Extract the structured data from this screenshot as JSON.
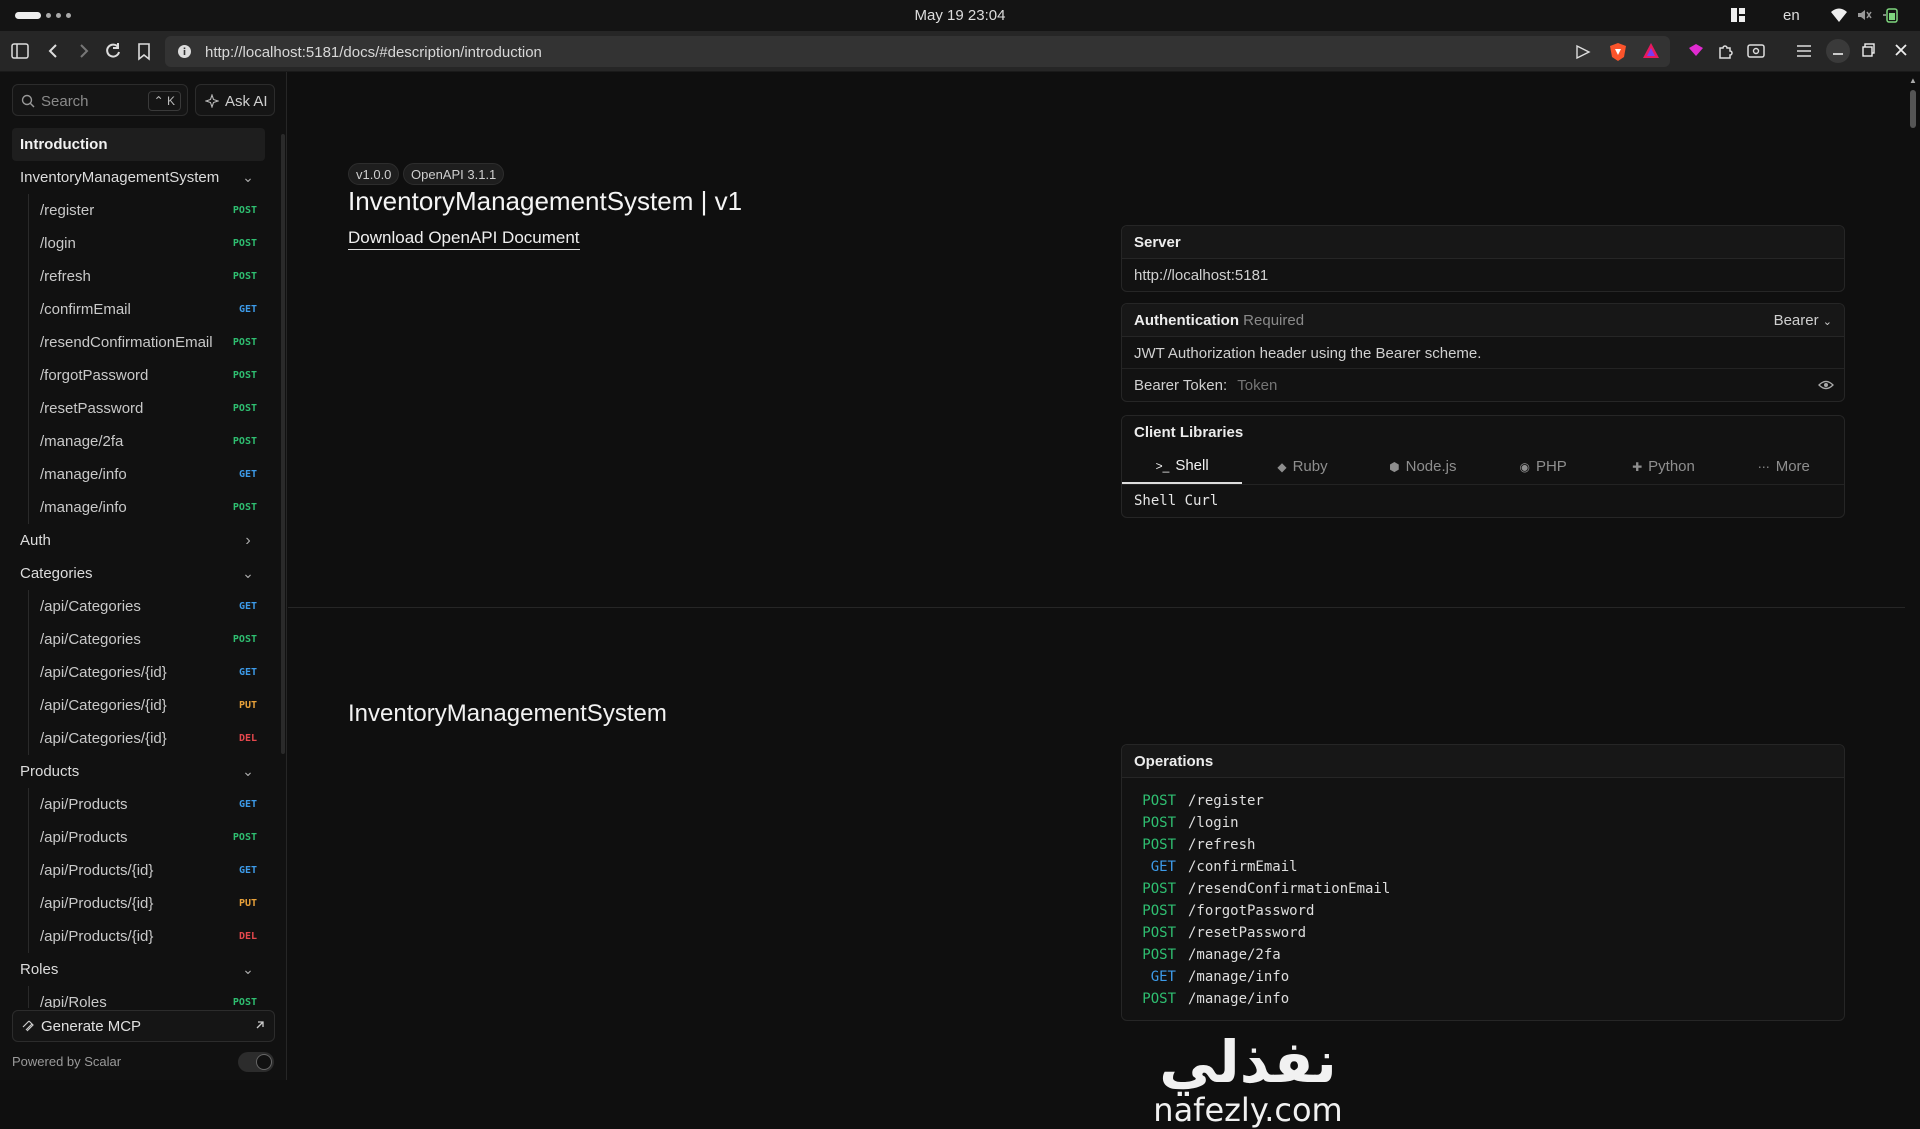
{
  "system": {
    "datetime": "May 19  23:04",
    "lang": "en"
  },
  "browser": {
    "url": "http://localhost:5181/docs/#description/introduction"
  },
  "sidebar": {
    "search_placeholder": "Search",
    "search_shortcut": "⌃ K",
    "ask_ai": "Ask AI",
    "items": [
      {
        "type": "section",
        "label": "Introduction",
        "active": true
      },
      {
        "type": "group",
        "label": "InventoryManagementSystem",
        "expanded": true
      },
      {
        "type": "endpoint",
        "label": "/register",
        "method": "POST"
      },
      {
        "type": "endpoint",
        "label": "/login",
        "method": "POST"
      },
      {
        "type": "endpoint",
        "label": "/refresh",
        "method": "POST"
      },
      {
        "type": "endpoint",
        "label": "/confirmEmail",
        "method": "GET"
      },
      {
        "type": "endpoint",
        "label": "/resendConfirmationEmail",
        "method": "POST"
      },
      {
        "type": "endpoint",
        "label": "/forgotPassword",
        "method": "POST"
      },
      {
        "type": "endpoint",
        "label": "/resetPassword",
        "method": "POST"
      },
      {
        "type": "endpoint",
        "label": "/manage/2fa",
        "method": "POST"
      },
      {
        "type": "endpoint",
        "label": "/manage/info",
        "method": "GET"
      },
      {
        "type": "endpoint",
        "label": "/manage/info",
        "method": "POST"
      },
      {
        "type": "group",
        "label": "Auth",
        "expanded": false
      },
      {
        "type": "group",
        "label": "Categories",
        "expanded": true
      },
      {
        "type": "endpoint",
        "label": "/api/Categories",
        "method": "GET"
      },
      {
        "type": "endpoint",
        "label": "/api/Categories",
        "method": "POST"
      },
      {
        "type": "endpoint",
        "label": "/api/Categories/{id}",
        "method": "GET"
      },
      {
        "type": "endpoint",
        "label": "/api/Categories/{id}",
        "method": "PUT"
      },
      {
        "type": "endpoint",
        "label": "/api/Categories/{id}",
        "method": "DEL"
      },
      {
        "type": "group",
        "label": "Products",
        "expanded": true
      },
      {
        "type": "endpoint",
        "label": "/api/Products",
        "method": "GET"
      },
      {
        "type": "endpoint",
        "label": "/api/Products",
        "method": "POST"
      },
      {
        "type": "endpoint",
        "label": "/api/Products/{id}",
        "method": "GET"
      },
      {
        "type": "endpoint",
        "label": "/api/Products/{id}",
        "method": "PUT"
      },
      {
        "type": "endpoint",
        "label": "/api/Products/{id}",
        "method": "DEL"
      },
      {
        "type": "group",
        "label": "Roles",
        "expanded": true
      },
      {
        "type": "endpoint",
        "label": "/api/Roles",
        "method": "POST"
      }
    ],
    "generate_mcp": "Generate MCP",
    "powered_by": "Powered by Scalar"
  },
  "main": {
    "version_tag": "v1.0.0",
    "openapi_tag": "OpenAPI 3.1.1",
    "title": "InventoryManagementSystem | v1",
    "download_link": "Download OpenAPI Document",
    "server": {
      "label": "Server",
      "url": "http://localhost:5181"
    },
    "auth": {
      "label": "Authentication",
      "required": "Required",
      "scheme": "Bearer",
      "description": "JWT Authorization header using the Bearer scheme.",
      "token_label": "Bearer Token:",
      "token_placeholder": "Token"
    },
    "client_libraries": {
      "label": "Client Libraries",
      "tabs": [
        {
          "label": "Shell",
          "icon": "terminal-icon",
          "active": true
        },
        {
          "label": "Ruby",
          "icon": "ruby-icon",
          "active": false
        },
        {
          "label": "Node.js",
          "icon": "nodejs-icon",
          "active": false
        },
        {
          "label": "PHP",
          "icon": "php-icon",
          "active": false
        },
        {
          "label": "Python",
          "icon": "python-icon",
          "active": false
        },
        {
          "label": "More",
          "icon": "more-icon",
          "active": false
        }
      ],
      "selected": "Shell Curl"
    },
    "section_title": "InventoryManagementSystem",
    "operations": {
      "label": "Operations",
      "items": [
        {
          "method": "POST",
          "path": "/register"
        },
        {
          "method": "POST",
          "path": "/login"
        },
        {
          "method": "POST",
          "path": "/refresh"
        },
        {
          "method": "GET",
          "path": "/confirmEmail"
        },
        {
          "method": "POST",
          "path": "/resendConfirmationEmail"
        },
        {
          "method": "POST",
          "path": "/forgotPassword"
        },
        {
          "method": "POST",
          "path": "/resetPassword"
        },
        {
          "method": "POST",
          "path": "/manage/2fa"
        },
        {
          "method": "GET",
          "path": "/manage/info"
        },
        {
          "method": "POST",
          "path": "/manage/info"
        }
      ]
    }
  },
  "watermark": {
    "arabic": "نفذلي",
    "latin": "nafezly.com"
  },
  "colors": {
    "post": "#2fbf71",
    "get": "#3d9be9",
    "put": "#e8a13a",
    "del": "#e5484d"
  }
}
